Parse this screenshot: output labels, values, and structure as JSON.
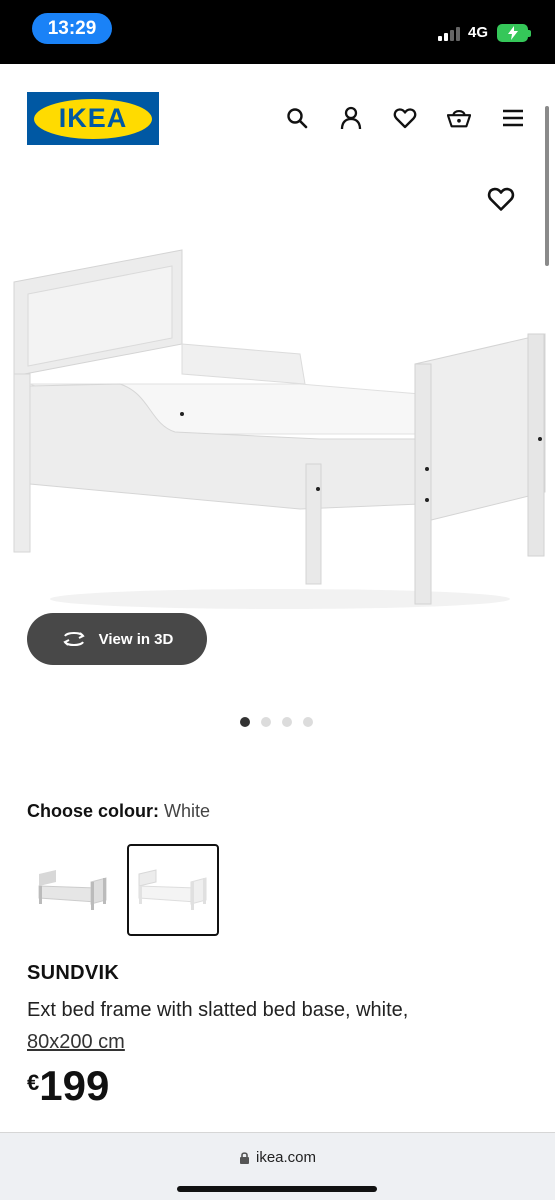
{
  "status_bar": {
    "time": "13:29",
    "network": "4G"
  },
  "header": {
    "logo_text": "IKEA",
    "icons": [
      "search-icon",
      "user-icon",
      "heart-icon",
      "basket-icon",
      "menu-icon"
    ]
  },
  "gallery": {
    "view_3d_label": "View in 3D",
    "dots": 4,
    "active_dot": 1
  },
  "colour": {
    "label": "Choose colour:",
    "value": "White",
    "options": [
      "grey-white",
      "white"
    ],
    "selected": 2
  },
  "product": {
    "name": "SUNDVIK",
    "description": "Ext bed frame with slatted bed base, white,",
    "size": "80x200 cm",
    "currency": "€",
    "price": "199"
  },
  "browser": {
    "url": "ikea.com"
  },
  "colors": {
    "brand_blue": "#0058a3",
    "brand_yellow": "#ffdb00",
    "time_pill": "#1a82f7"
  }
}
